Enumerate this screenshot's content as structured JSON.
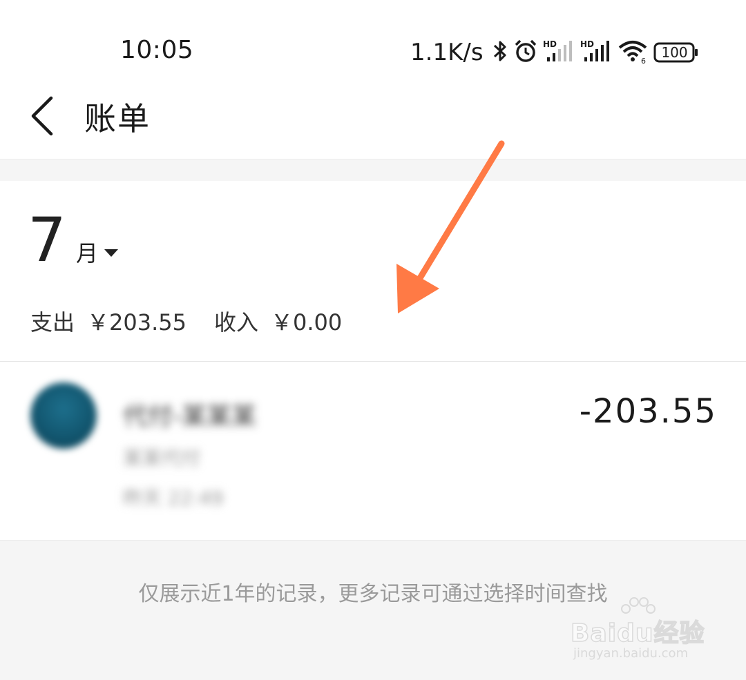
{
  "status_bar": {
    "time": "10:05",
    "net_speed": "1.1K/s",
    "battery": "100",
    "icons": [
      "bluetooth-icon",
      "alarm-icon",
      "signal-hd-icon",
      "signal-hd-icon",
      "wifi-icon",
      "battery-icon"
    ]
  },
  "header": {
    "title": "账单",
    "back_icon": "chevron-left-icon"
  },
  "month_section": {
    "month": "7",
    "month_unit": "月",
    "expense_label": "支出",
    "expense_value": "￥203.55",
    "income_label": "收入",
    "income_value": "￥0.00"
  },
  "transactions": [
    {
      "name": "代付-某某某",
      "sub": "某某代付",
      "time": "昨天  22:49",
      "amount": "-203.55"
    }
  ],
  "footer": {
    "note": "仅展示近1年的记录，更多记录可通过选择时间查找"
  },
  "watermark": {
    "brand": "Baidu经验",
    "url": "jingyan.baidu.com"
  },
  "colors": {
    "annotation_arrow": "#ff7a45",
    "page_background_gray": "#f5f5f5",
    "text_primary": "#222222",
    "text_muted": "#9a9a9a"
  }
}
